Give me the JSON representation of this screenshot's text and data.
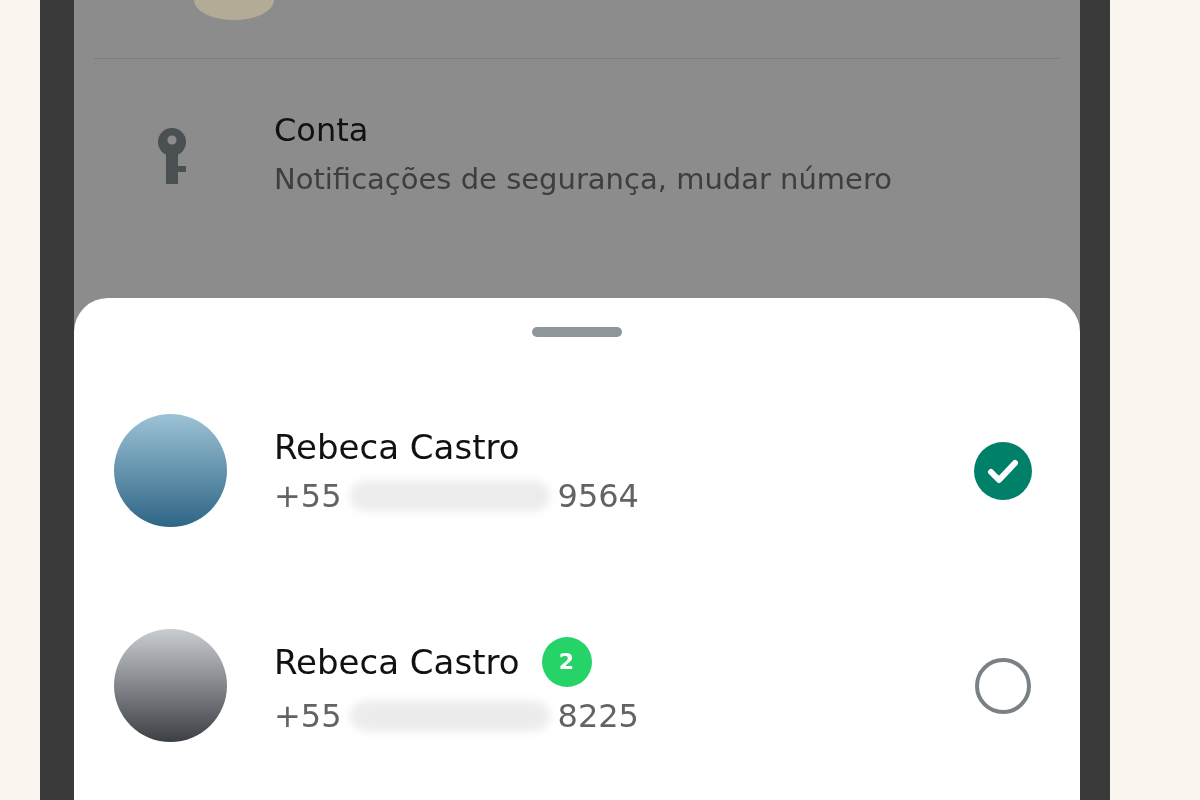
{
  "settings_item": {
    "title": "Conta",
    "subtitle": "Notificações de segurança, mudar número"
  },
  "accounts": [
    {
      "name": "Rebeca Castro",
      "phone_prefix": "+55",
      "phone_suffix": "9564",
      "selected": true
    },
    {
      "name": "Rebeca Castro",
      "phone_prefix": "+55",
      "phone_suffix": "8225",
      "badge": "2",
      "selected": false
    }
  ]
}
